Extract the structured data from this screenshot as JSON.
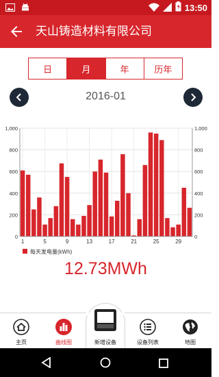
{
  "status_bar": {
    "time": "13:50"
  },
  "app_bar": {
    "title": "天山铸造材料有限公司"
  },
  "period_tabs": [
    {
      "label": "日",
      "active": false
    },
    {
      "label": "月",
      "active": true
    },
    {
      "label": "年",
      "active": false
    },
    {
      "label": "历年",
      "active": false
    }
  ],
  "current_period": "2016-01",
  "chart_data": {
    "type": "bar",
    "x": [
      1,
      2,
      3,
      4,
      5,
      6,
      7,
      8,
      9,
      10,
      11,
      12,
      13,
      14,
      15,
      16,
      17,
      18,
      19,
      20,
      21,
      22,
      23,
      24,
      25,
      26,
      27,
      28,
      29,
      30,
      31
    ],
    "values": [
      610,
      570,
      250,
      360,
      110,
      170,
      280,
      675,
      550,
      160,
      110,
      190,
      290,
      600,
      710,
      590,
      185,
      330,
      760,
      400,
      10,
      160,
      660,
      960,
      950,
      890,
      170,
      85,
      110,
      450,
      265
    ],
    "ylim": [
      0,
      1000
    ],
    "y_ticks": [
      "0",
      "200",
      "400",
      "600",
      "800",
      "1,000"
    ],
    "x_ticks": [
      {
        "x": 1,
        "label": "1"
      },
      {
        "x": 5,
        "label": "5"
      },
      {
        "x": 9,
        "label": "9"
      },
      {
        "x": 13,
        "label": "13"
      },
      {
        "x": 17,
        "label": "17"
      },
      {
        "x": 21,
        "label": "21"
      },
      {
        "x": 25,
        "label": "25"
      },
      {
        "x": 29,
        "label": "29"
      }
    ],
    "legend": "每天发电量(kWh)",
    "legend_position": "bottom-left",
    "grid": true,
    "bar_color": "#d7262c"
  },
  "total_energy": "12.73MWh",
  "bottom_nav": {
    "home": "主页",
    "curve": "曲线图",
    "add_device": "新增设备",
    "device_list": "设备列表",
    "map": "地图"
  },
  "colors": {
    "primary": "#d7262c",
    "status_bar": "#c5191f",
    "nav_button": "#1f2836"
  }
}
